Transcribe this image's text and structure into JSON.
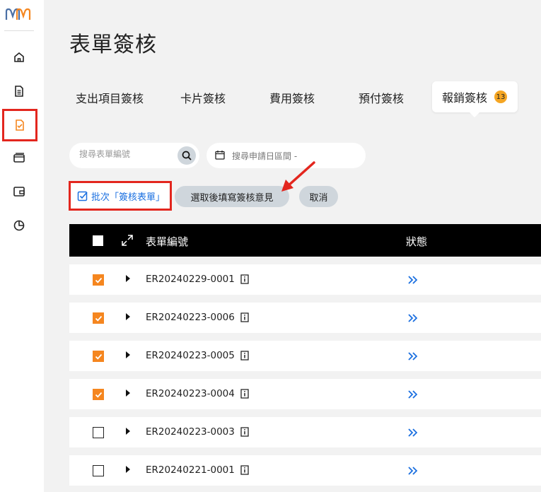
{
  "sidebar": {
    "logo_text": "MM",
    "items": [
      {
        "icon": "home-icon"
      },
      {
        "icon": "document-icon"
      },
      {
        "icon": "form-approve-icon",
        "active": true
      },
      {
        "icon": "card-icon"
      },
      {
        "icon": "wallet-icon"
      },
      {
        "icon": "pie-chart-icon"
      }
    ]
  },
  "page": {
    "title": "表單簽核"
  },
  "tabs": [
    {
      "label": "支出項目簽核"
    },
    {
      "label": "卡片簽核"
    },
    {
      "label": "費用簽核"
    },
    {
      "label": "預付簽核"
    },
    {
      "label": "報銷簽核",
      "badge": "13",
      "active": true
    }
  ],
  "filters": {
    "search_placeholder": "搜尋表單編號",
    "date_placeholder": "搜尋申請日區間 -"
  },
  "actions": {
    "batch_label": "批次「簽核表單」",
    "fill_opinion_label": "選取後填寫簽核意見",
    "cancel_label": "取消"
  },
  "table": {
    "headers": [
      "表單編號",
      "狀態"
    ],
    "rows": [
      {
        "id": "ER20240229-0001",
        "checked": true
      },
      {
        "id": "ER20240223-0006",
        "checked": true
      },
      {
        "id": "ER20240223-0005",
        "checked": true
      },
      {
        "id": "ER20240223-0004",
        "checked": true
      },
      {
        "id": "ER20240223-0003",
        "checked": false
      },
      {
        "id": "ER20240221-0001",
        "checked": false
      }
    ]
  },
  "colors": {
    "accent_orange": "#f5861f",
    "highlight_red": "#e3261e",
    "link_blue": "#1a6fe0",
    "badge": "#f5a623"
  }
}
